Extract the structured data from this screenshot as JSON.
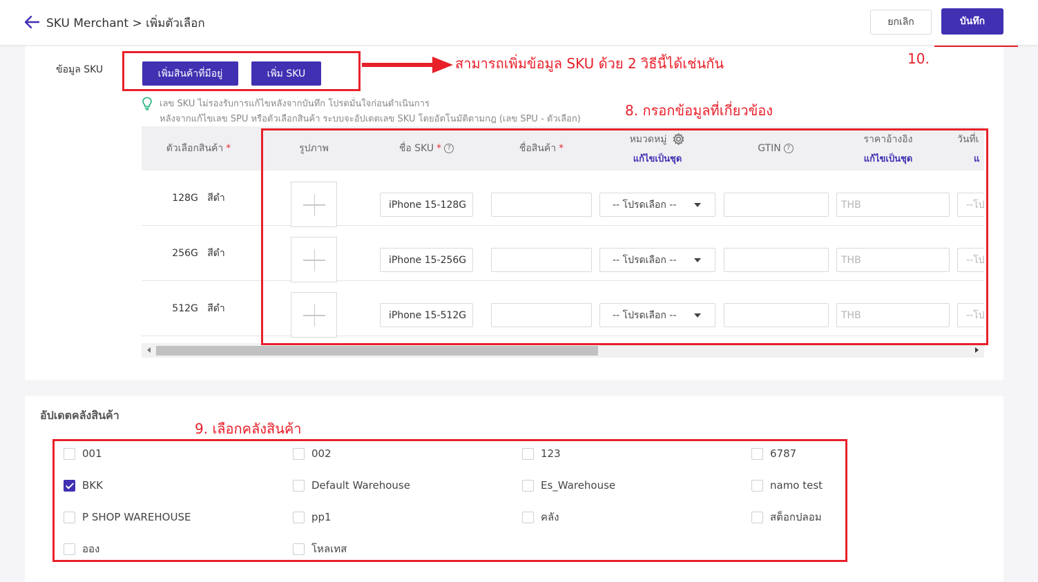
{
  "header": {
    "breadcrumb": "SKU Merchant > เพิ่มตัวเลือก",
    "cancel_label": "ยกเลิก",
    "save_label": "บันทึก"
  },
  "sku_section": {
    "label": "ข้อมูล SKU",
    "add_existing_label": "เพิ่มสินค้าที่มีอยู่",
    "add_sku_label": "เพิ่ม SKU",
    "tip_line1": "เลข SKU ไม่รองรับการแก้ไขหลังจากบันทึก โปรดมั่นใจก่อนดำเนินการ",
    "tip_line2": "หลังจากแก้ไขเลข SPU หรือตัวเลือกสินค้า ระบบจะอัปเดตเลข SKU โดยอัตโนมัติตามกฎ (เลข SPU - ตัวเลือก)"
  },
  "table": {
    "headers": {
      "option": "ตัวเลือกสินค้า",
      "image": "รูปภาพ",
      "sku_name": "ชื่อ SKU",
      "product_name": "ชื่อสินค้า",
      "category": "หมวดหมู่",
      "category_sub": "แก้ไขเป็นชุด",
      "gtin": "GTIN",
      "ref_price": "ราคาอ้างอิง",
      "ref_price_sub": "แก้ไขเป็นชุด",
      "date": "วันที่เ",
      "date_sub": "แ"
    },
    "required_mark": "*",
    "help_mark": "?",
    "rows": [
      {
        "option": "128G   สีดำ",
        "sku_name": "iPhone 15-128G",
        "product_name": "",
        "category": "-- โปรดเลือก --",
        "gtin": "",
        "price_placeholder": "THB",
        "date_placeholder": "--โปรด"
      },
      {
        "option": "256G   สีดำ",
        "sku_name": "iPhone 15-256G",
        "product_name": "",
        "category": "-- โปรดเลือก --",
        "gtin": "",
        "price_placeholder": "THB",
        "date_placeholder": "--โปรด"
      },
      {
        "option": "512G   สีดำ",
        "sku_name": "iPhone 15-512G",
        "product_name": "",
        "category": "-- โปรดเลือก --",
        "gtin": "",
        "price_placeholder": "THB",
        "date_placeholder": "--โปรด"
      }
    ]
  },
  "warehouse": {
    "title": "อัปเดตคลังสินค้า",
    "items": [
      {
        "label": "001",
        "checked": false
      },
      {
        "label": "002",
        "checked": false
      },
      {
        "label": "123",
        "checked": false
      },
      {
        "label": "6787",
        "checked": false
      },
      {
        "label": "BKK",
        "checked": true
      },
      {
        "label": "Default Warehouse",
        "checked": false
      },
      {
        "label": "Es_Warehouse",
        "checked": false
      },
      {
        "label": "namo test",
        "checked": false
      },
      {
        "label": "P SHOP WAREHOUSE",
        "checked": false
      },
      {
        "label": "pp1",
        "checked": false
      },
      {
        "label": "คลัง",
        "checked": false
      },
      {
        "label": "สต็อกปลอม",
        "checked": false
      },
      {
        "label": "ออง",
        "checked": false
      },
      {
        "label": "โหลเทส",
        "checked": false
      }
    ]
  },
  "annotations": {
    "add_methods": "สามารถเพิ่มข้อมูล SKU ด้วย 2 วิธีนี้ได้เช่นกัน",
    "step8": "8. กรอกข้อมูลที่เกี่ยวข้อง",
    "step9": "9. เลือกคลังสินค้า",
    "step10": "10."
  },
  "colors": {
    "primary": "#4030b2",
    "annotation_red": "#e8202a"
  }
}
